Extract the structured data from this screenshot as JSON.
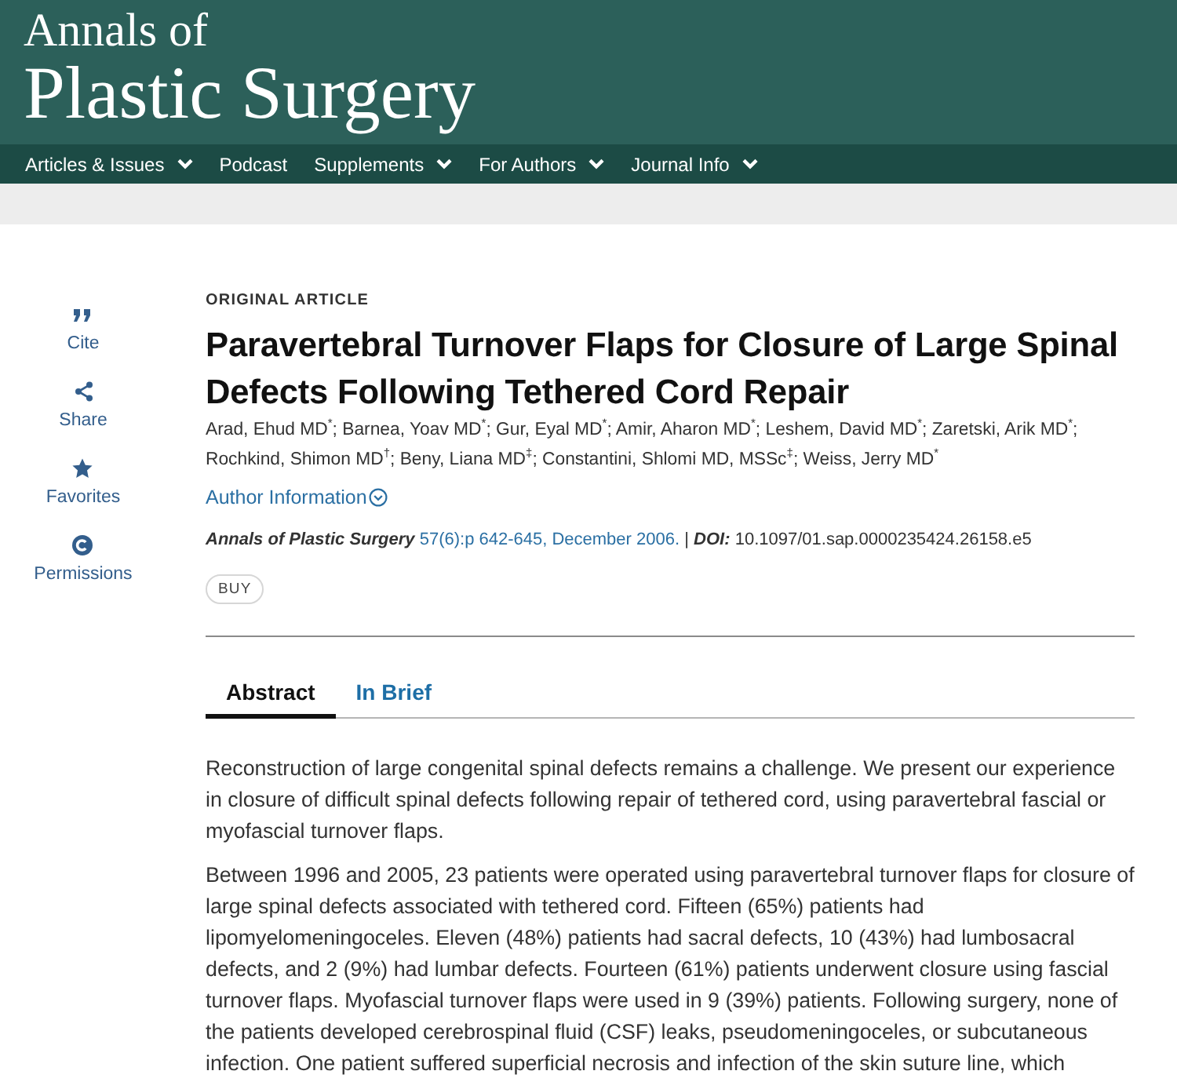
{
  "journal": {
    "line1": "Annals of",
    "line2": "Plastic Surgery"
  },
  "nav": [
    {
      "label": "Articles & Issues",
      "dropdown": true
    },
    {
      "label": "Podcast",
      "dropdown": false
    },
    {
      "label": "Supplements",
      "dropdown": true
    },
    {
      "label": "For Authors",
      "dropdown": true
    },
    {
      "label": "Journal Info",
      "dropdown": true
    }
  ],
  "sidebar": [
    {
      "kind": "cite",
      "label": "Cite"
    },
    {
      "kind": "share",
      "label": "Share"
    },
    {
      "kind": "favorite",
      "label": "Favorites"
    },
    {
      "kind": "permissions",
      "label": "Permissions"
    }
  ],
  "article": {
    "type": "ORIGINAL ARTICLE",
    "title": "Paravertebral Turnover Flaps for Closure of Large Spinal Defects Following Tethered Cord Repair",
    "authors": "Arad, Ehud MD$^{*}$; Barnea, Yoav MD$^{*}$; Gur, Eyal MD$^{*}$; Amir, Aharon MD$^{*}$; Leshem, David MD$^{*}$; Zaretski, Arik MD$^{*}$; Rochkind, Shimon MD$^{†}$; Beny, Liana MD$^{‡}$; Constantini, Shlomi MD, MSSc$^{‡}$; Weiss, Jerry MD$^{*}$",
    "author_info": "Author Information",
    "citation": {
      "journal": "Annals of Plastic Surgery",
      "issue": "57(6):p 642-645, December 2006.",
      "separator": "|",
      "doi_label": "DOI:",
      "doi": "10.1097/01.sap.0000235424.26158.e5"
    },
    "buy": "BUY"
  },
  "tabs": [
    {
      "label": "Abstract",
      "selected": true
    },
    {
      "label": "In Brief",
      "selected": false
    }
  ],
  "abstract": [
    "Reconstruction of large congenital spinal defects remains a challenge. We present our experience in closure of difficult spinal defects following repair of tethered cord, using paravertebral fascial or myofascial turnover flaps.",
    "Between 1996 and 2005, 23 patients were operated using paravertebral turnover flaps for closure of large spinal defects associated with tethered cord. Fifteen (65%) patients had lipomyelomeningoceles. Eleven (48%) patients had sacral defects, 10 (43%) had lumbosacral defects, and 2 (9%) had lumbar defects. Fourteen (61%) patients underwent closure using fascial turnover flaps. Myofascial turnover flaps were used in 9 (39%) patients. Following surgery, none of the patients developed cerebrospinal fluid (CSF) leaks, pseudomeningoceles, or subcutaneous infection. One patient suffered superficial necrosis and infection of the skin suture line, which"
  ]
}
